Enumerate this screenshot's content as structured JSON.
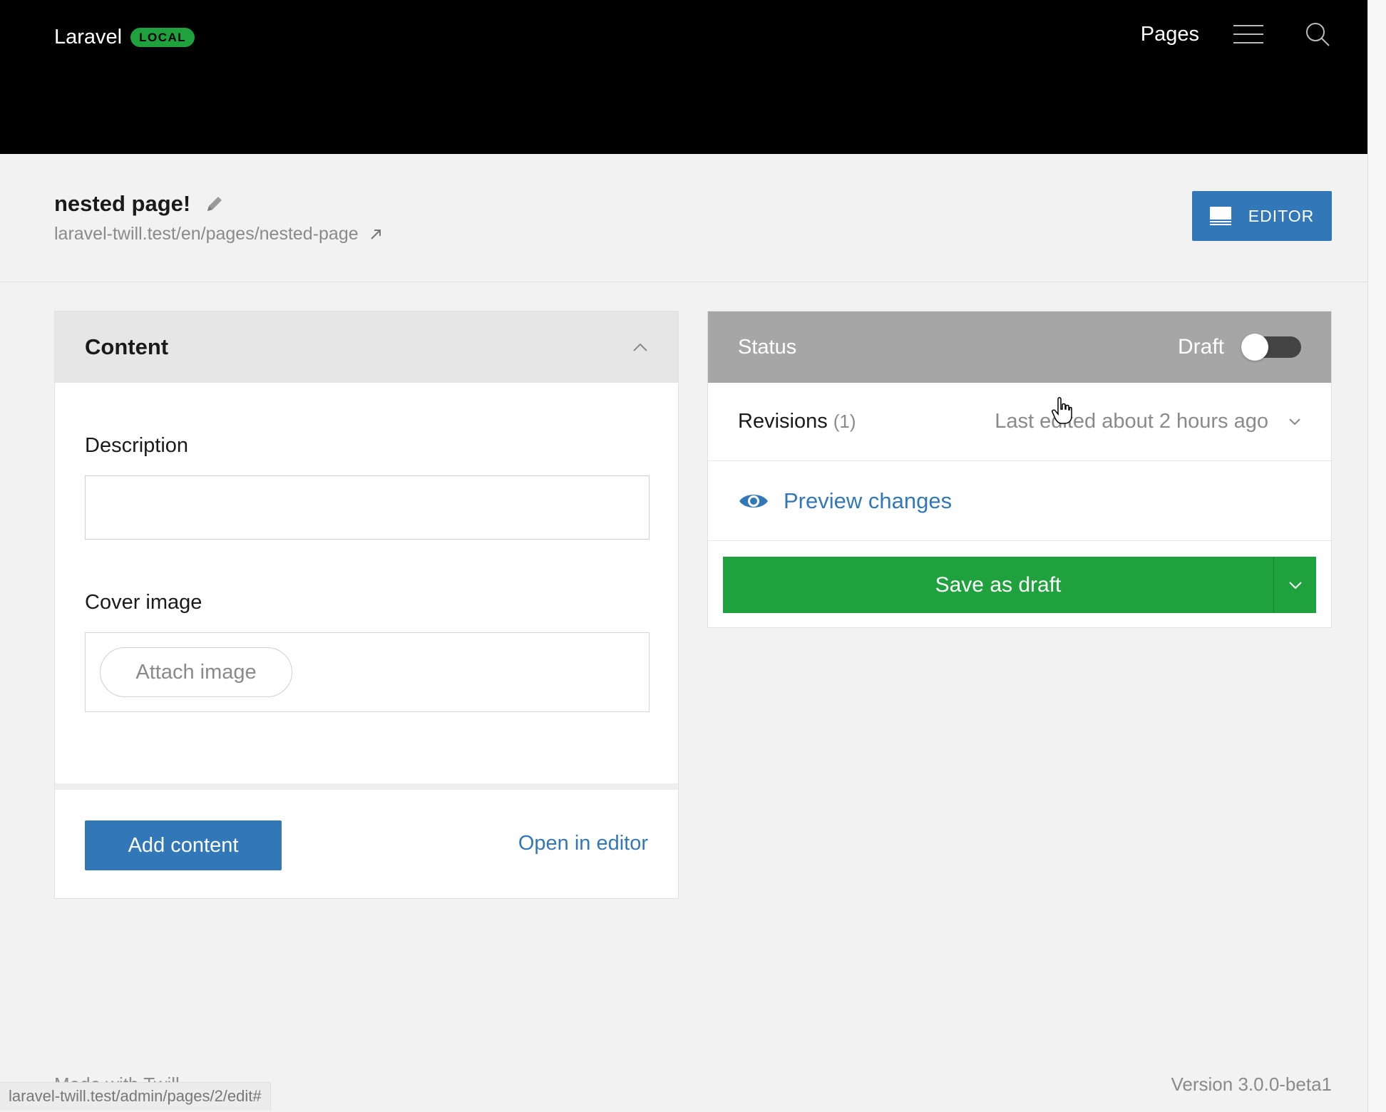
{
  "header": {
    "brand": "Laravel",
    "env_badge": "LOCAL",
    "nav_pages": "Pages"
  },
  "titlebar": {
    "page_title": "nested page!",
    "permalink": "laravel-twill.test/en/pages/nested-page",
    "editor_button": "EDITOR"
  },
  "content": {
    "title": "Content",
    "description_label": "Description",
    "description_value": "",
    "cover_label": "Cover image",
    "attach_button": "Attach image",
    "add_content_button": "Add content",
    "open_editor_link": "Open in editor"
  },
  "status": {
    "title": "Status",
    "draft_label": "Draft",
    "published": false,
    "revisions_label": "Revisions",
    "revisions_count": "(1)",
    "last_edited": "Last edited about 2 hours ago",
    "preview_label": "Preview changes",
    "save_button": "Save as draft"
  },
  "footer": {
    "made_with": "Made with Twill",
    "version": "Version 3.0.0-beta1"
  },
  "browser_status_url": "laravel-twill.test/admin/pages/2/edit#",
  "colors": {
    "header_bg": "#000000",
    "badge_green": "#1fa13d",
    "primary_blue": "#3278b8",
    "save_green": "#1fa13d",
    "status_header_gray": "#a6a6a6",
    "content_header_gray": "#e6e6e6"
  },
  "icons": {
    "menu": "hamburger-menu-icon",
    "search": "search-icon",
    "edit_title": "pencil-icon",
    "external_link": "external-link-icon",
    "editor": "editor-layout-icon",
    "collapse": "chevron-up-icon",
    "revisions_expand": "chevron-down-icon",
    "preview": "eye-icon",
    "save_options": "chevron-down-icon"
  }
}
